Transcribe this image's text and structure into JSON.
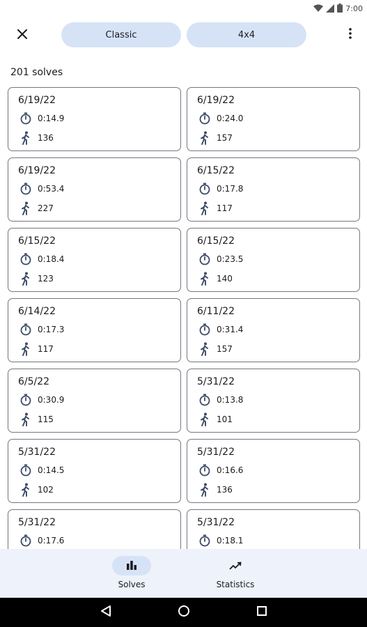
{
  "status_bar": {
    "time": "7:00"
  },
  "top_bar": {
    "mode_chip": "Classic",
    "size_chip": "4x4"
  },
  "summary": {
    "solves_count": "201 solves"
  },
  "solves": [
    {
      "date": "6/19/22",
      "time": "0:14.9",
      "moves": "136"
    },
    {
      "date": "6/19/22",
      "time": "0:24.0",
      "moves": "157"
    },
    {
      "date": "6/19/22",
      "time": "0:53.4",
      "moves": "227"
    },
    {
      "date": "6/15/22",
      "time": "0:17.8",
      "moves": "117"
    },
    {
      "date": "6/15/22",
      "time": "0:18.4",
      "moves": "123"
    },
    {
      "date": "6/15/22",
      "time": "0:23.5",
      "moves": "140"
    },
    {
      "date": "6/14/22",
      "time": "0:17.3",
      "moves": "117"
    },
    {
      "date": "6/11/22",
      "time": "0:31.4",
      "moves": "157"
    },
    {
      "date": "6/5/22",
      "time": "0:30.9",
      "moves": "115"
    },
    {
      "date": "5/31/22",
      "time": "0:13.8",
      "moves": "101"
    },
    {
      "date": "5/31/22",
      "time": "0:14.5",
      "moves": "102"
    },
    {
      "date": "5/31/22",
      "time": "0:16.6",
      "moves": "136"
    },
    {
      "date": "5/31/22",
      "time": "0:17.6",
      "moves": ""
    },
    {
      "date": "5/31/22",
      "time": "0:18.1",
      "moves": ""
    }
  ],
  "bottom_nav": {
    "solves_label": "Solves",
    "statistics_label": "Statistics"
  },
  "icons": {
    "close": "close-icon",
    "more": "more-vert-icon",
    "timer": "stopwatch-icon",
    "moves": "walking-person-icon",
    "solves_tab": "bar-chart-icon",
    "stats_tab": "trending-up-icon"
  },
  "colors": {
    "chip": "#d6e3f7",
    "nav_bg": "#eef2fa",
    "icon": "#3b4a66",
    "card_border": "#74777f"
  }
}
